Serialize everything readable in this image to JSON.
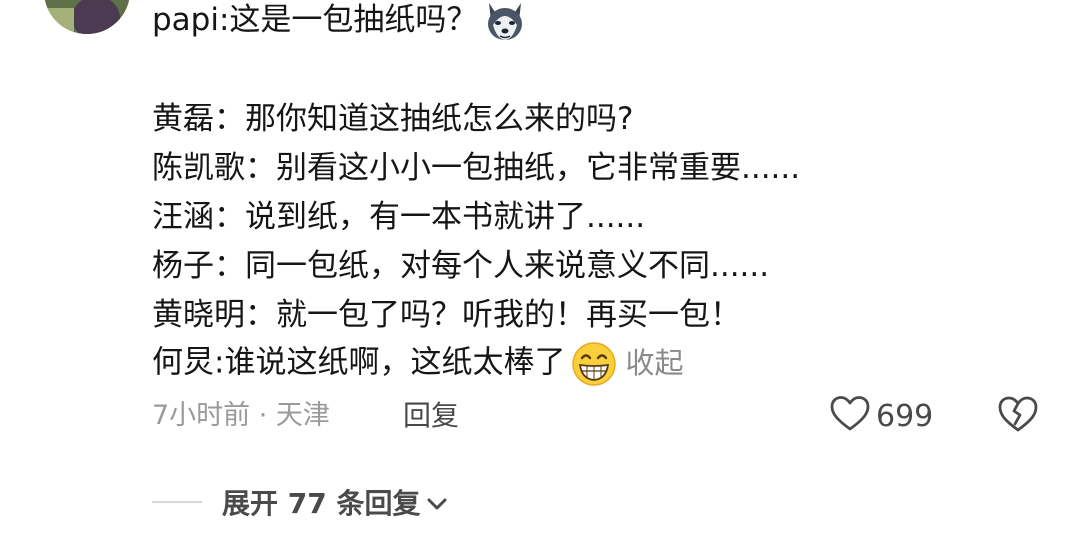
{
  "comment": {
    "lines": [
      "papi:这是一包抽纸吗？",
      "黄磊：那你知道这抽纸怎么来的吗?",
      "陈凯歌：别看这小小一包抽纸，它非常重要......",
      "汪涵：说到纸，有一本书就讲了......",
      "杨子：同一包纸，对每个人来说意义不同......",
      "黄晓明：就一包了吗？听我的！再买一包！",
      "何炅:谁说这纸啊，这纸太棒了"
    ],
    "emoji_1": "husky-dog-emoji",
    "emoji_2": "grinning-face-emoji",
    "collapse_label": "收起"
  },
  "meta": {
    "time_location": "7小时前 · 天津",
    "reply_label": "回复"
  },
  "actions": {
    "like_icon": "heart-outline-icon",
    "like_count": "699",
    "dislike_icon": "broken-heart-icon"
  },
  "replies": {
    "expand_label": "展开 77 条回复",
    "expand_icon": "chevron-down-icon"
  }
}
